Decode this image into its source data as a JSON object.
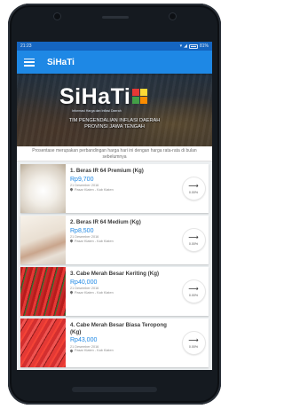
{
  "statusbar": {
    "time": "21:23",
    "battery": "81%"
  },
  "appbar": {
    "title": "SiHaTi"
  },
  "banner": {
    "logo": "SiHaTi",
    "tagline": "Informasi Harga dan Inflasi Daerah",
    "caption_line1": "TIM PENGENDALIAN INFLASI DAERAH",
    "caption_line2": "PROVINSI JAWA TENGAH"
  },
  "notice": "Prosentase merupakan perbandingan harga hari ini dengan harga rata-rata di bulan sebelumnya",
  "items": [
    {
      "name": "1. Beras IR 64 Premium (Kg)",
      "price": "Rp9,700",
      "date": "21 Desember 2016",
      "market": "Pasar Klaten - Kab Klaten",
      "change": "0.00%"
    },
    {
      "name": "2. Beras IR 64 Medium (Kg)",
      "price": "Rp8,500",
      "date": "21 Desember 2016",
      "market": "Pasar Klaten - Kab Klaten",
      "change": "0.00%"
    },
    {
      "name": "3. Cabe Merah Besar Keriting (Kg)",
      "price": "Rp40,000",
      "date": "21 Desember 2016",
      "market": "Pasar Klaten - Kab Klaten",
      "change": "0.00%"
    },
    {
      "name": "4. Cabe Merah Besar Biasa Teropong (Kg)",
      "price": "Rp43,000",
      "date": "21 Desember 2016",
      "market": "Pasar Klaten - Kab Klaten",
      "change": "0.00%"
    }
  ],
  "icons": {
    "menu": "menu-icon",
    "trend": "arrow-right-icon",
    "location": "location-pin-icon"
  },
  "colors": {
    "appbar": "#1e88e5",
    "statusbar": "#1565c0",
    "price": "#1e88e5"
  }
}
